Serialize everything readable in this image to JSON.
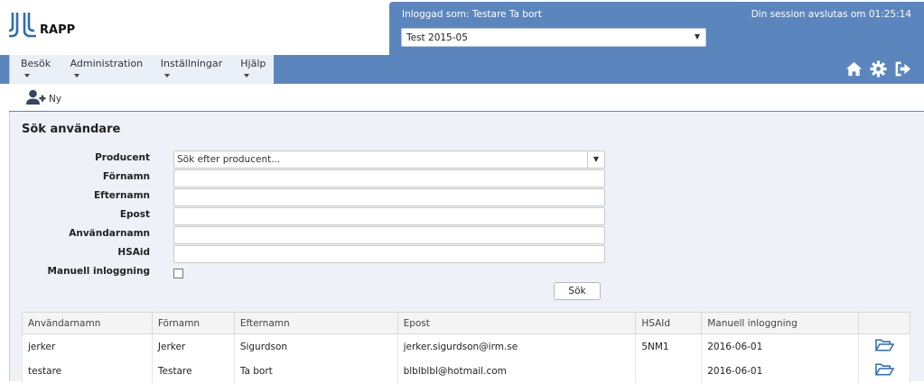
{
  "brand": {
    "name": "RAPP",
    "logo_icon": "rapp-logo-icon"
  },
  "session": {
    "logged_in_text": "Inloggad som: Testare Ta bort",
    "ends_text": "Din session avslutas om 01:25:14",
    "unit_select": {
      "value": "Test 2015-05",
      "arrow": "▼"
    }
  },
  "menu": {
    "items": [
      {
        "label": "Besök"
      },
      {
        "label": "Administration"
      },
      {
        "label": "Inställningar"
      },
      {
        "label": "Hjälp"
      }
    ]
  },
  "nav_icons": [
    "home-icon",
    "gear-icon",
    "logout-icon"
  ],
  "toolbar": {
    "new_label": "Ny",
    "new_icon": "add-user-icon"
  },
  "search": {
    "title": "Sök användare",
    "fields": {
      "producent": {
        "label": "Producent",
        "placeholder": "Sök efter producent...",
        "arrow": "▼"
      },
      "fornamn": {
        "label": "Förnamn",
        "value": ""
      },
      "efternamn": {
        "label": "Efternamn",
        "value": ""
      },
      "epost": {
        "label": "Epost",
        "value": ""
      },
      "anvandarnamn": {
        "label": "Användarnamn",
        "value": ""
      },
      "hsaid": {
        "label": "HSAid",
        "value": ""
      },
      "manuell": {
        "label": "Manuell inloggning",
        "checked": false
      }
    },
    "search_button": "Sök"
  },
  "table": {
    "headers": [
      "Användarnamn",
      "Förnamn",
      "Efternamn",
      "Epost",
      "HSAId",
      "Manuell inloggning",
      ""
    ],
    "rows": [
      {
        "username": "jerker",
        "firstname": "Jerker",
        "lastname": "Sigurdson",
        "email": "jerker.sigurdson@irm.se",
        "hsaid": "5NM1",
        "manual_login": "2016-06-01",
        "action_icon": "folder-open-icon"
      },
      {
        "username": "testare",
        "firstname": "Testare",
        "lastname": "Ta bort",
        "email": "blblblbl@hotmail.com",
        "hsaid": "",
        "manual_login": "2016-06-01",
        "action_icon": "folder-open-icon"
      }
    ]
  },
  "colors": {
    "header_blue": "#5b86bd",
    "content_bg": "#eef2f8",
    "icon_blue": "#2e6db4"
  }
}
